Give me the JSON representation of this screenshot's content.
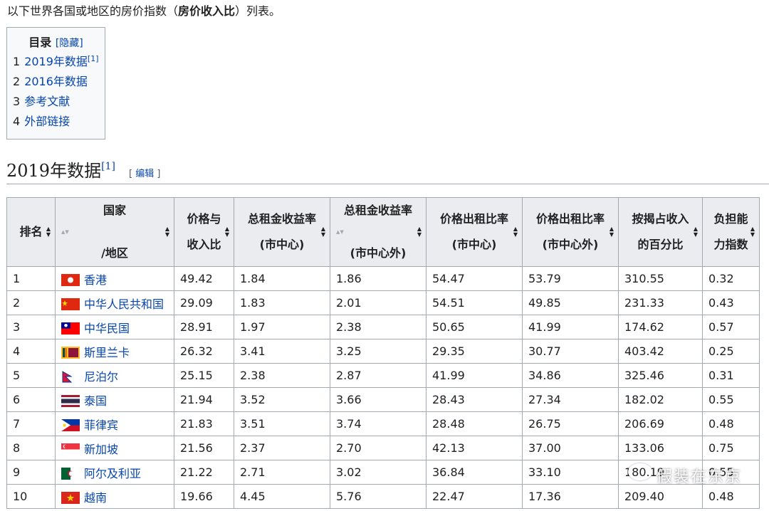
{
  "intro": {
    "prefix": "以下世界各国或地区的房价指数（",
    "bold": "房价收入比",
    "suffix": "）列表。"
  },
  "toc": {
    "title": "目录",
    "toggle": "[隐藏]",
    "items": [
      {
        "num": "1",
        "label": "2019年数据",
        "sup": "[1]"
      },
      {
        "num": "2",
        "label": "2016年数据",
        "sup": ""
      },
      {
        "num": "3",
        "label": "参考文献",
        "sup": ""
      },
      {
        "num": "4",
        "label": "外部链接",
        "sup": ""
      }
    ]
  },
  "section": {
    "title": "2019年数据",
    "sup": "[1]",
    "edit_open": "[ ",
    "edit_label": "编辑",
    "edit_close": " ]"
  },
  "chart_data": {
    "type": "table",
    "columns": [
      {
        "line1": "排名",
        "line2": "",
        "line3": ""
      },
      {
        "line1": "国家",
        "line2": "",
        "line3": "/地区"
      },
      {
        "line1": "价格与",
        "line2": "收入比",
        "line3": ""
      },
      {
        "line1": "总租金收益率",
        "line2": "(市中心)",
        "line3": ""
      },
      {
        "line1": "总租金收益率",
        "line2": "",
        "line3": "(市中心外)"
      },
      {
        "line1": "价格出租比率",
        "line2": "(市中心)",
        "line3": ""
      },
      {
        "line1": "价格出租比率",
        "line2": "(市中心外)",
        "line3": ""
      },
      {
        "line1": "按揭占收入",
        "line2": "的百分比",
        "line3": ""
      },
      {
        "line1": "负担能",
        "line2": "力指数",
        "line3": ""
      }
    ],
    "rows": [
      {
        "rank": "1",
        "country": "香港",
        "flag": "hk",
        "cells": [
          "49.42",
          "1.84",
          "1.86",
          "54.47",
          "53.79",
          "310.55",
          "0.32"
        ]
      },
      {
        "rank": "2",
        "country": "中华人民共和国",
        "flag": "cn",
        "cells": [
          "29.09",
          "1.83",
          "2.01",
          "54.51",
          "49.85",
          "231.33",
          "0.43"
        ]
      },
      {
        "rank": "3",
        "country": "中华民国",
        "flag": "tw",
        "cells": [
          "28.91",
          "1.97",
          "2.38",
          "50.65",
          "41.99",
          "174.62",
          "0.57"
        ]
      },
      {
        "rank": "4",
        "country": "斯里兰卡",
        "flag": "lk",
        "cells": [
          "26.32",
          "3.41",
          "3.25",
          "29.35",
          "30.77",
          "403.42",
          "0.25"
        ]
      },
      {
        "rank": "5",
        "country": "尼泊尔",
        "flag": "np",
        "cells": [
          "25.15",
          "2.38",
          "2.87",
          "41.99",
          "34.86",
          "325.46",
          "0.31"
        ]
      },
      {
        "rank": "6",
        "country": "泰国",
        "flag": "th",
        "cells": [
          "21.94",
          "3.52",
          "3.66",
          "28.43",
          "27.34",
          "182.02",
          "0.55"
        ]
      },
      {
        "rank": "7",
        "country": "菲律宾",
        "flag": "ph",
        "cells": [
          "21.83",
          "3.51",
          "3.74",
          "28.48",
          "26.75",
          "206.69",
          "0.48"
        ]
      },
      {
        "rank": "8",
        "country": "新加坡",
        "flag": "sg",
        "cells": [
          "21.56",
          "2.37",
          "2.70",
          "42.13",
          "37.00",
          "133.06",
          "0.75"
        ]
      },
      {
        "rank": "9",
        "country": "阿尔及利亚",
        "flag": "dz",
        "cells": [
          "21.22",
          "2.71",
          "3.02",
          "36.84",
          "33.10",
          "180.19",
          "0.55"
        ]
      },
      {
        "rank": "10",
        "country": "越南",
        "flag": "vn",
        "cells": [
          "19.66",
          "4.45",
          "5.76",
          "22.47",
          "17.36",
          "209.40",
          "0.48"
        ]
      }
    ]
  },
  "watermark": {
    "text": "假装在东京"
  },
  "icons": {
    "sort": "sort-icon",
    "watermark": "wechat-icon"
  }
}
